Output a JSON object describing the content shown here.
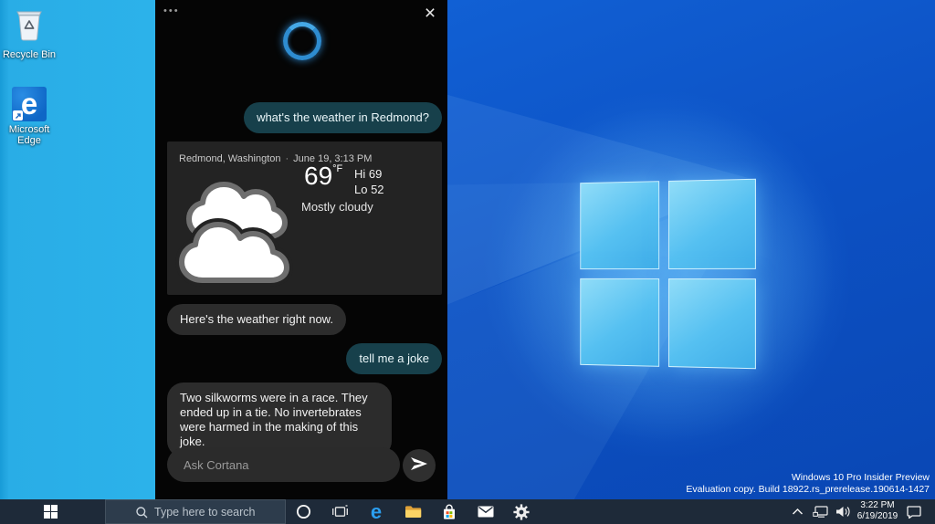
{
  "desktop": {
    "icons": [
      {
        "label": "Recycle Bin"
      },
      {
        "label": "Microsoft Edge"
      }
    ],
    "watermark": {
      "line1": "Windows 10 Pro Insider Preview",
      "line2": "Evaluation copy. Build 18922.rs_prerelease.190614-1427"
    }
  },
  "cortana": {
    "more_label": "•••",
    "close_label": "×",
    "messages": {
      "user1": "what's the weather in Redmond?",
      "bot1": "Here's the weather right now.",
      "user2": "tell me a joke",
      "bot2": "Two silkworms were in a race. They ended up in a tie. No invertebrates were harmed in the making of this joke."
    },
    "weather": {
      "location": "Redmond, Washington",
      "separator": "·",
      "datetime": "June 19, 3:13 PM",
      "temp": "69",
      "unit": "°F",
      "hi": "Hi 69",
      "lo": "Lo 52",
      "condition": "Mostly cloudy"
    },
    "input": {
      "placeholder": "Ask Cortana"
    }
  },
  "taskbar": {
    "search_placeholder": "Type here to search",
    "tray": {
      "time": "3:22 PM",
      "date": "6/19/2019"
    }
  },
  "colors": {
    "desktop_band": "#2cb2ea",
    "wallpaper_base": "#0c51c4",
    "logo_pane": "#55c0f1",
    "taskbar": "#1e2a39",
    "user_bubble": "#17404b",
    "bot_bubble": "#2c2c2c",
    "card": "#232323",
    "cortana_ring": "#2e8cd0"
  }
}
